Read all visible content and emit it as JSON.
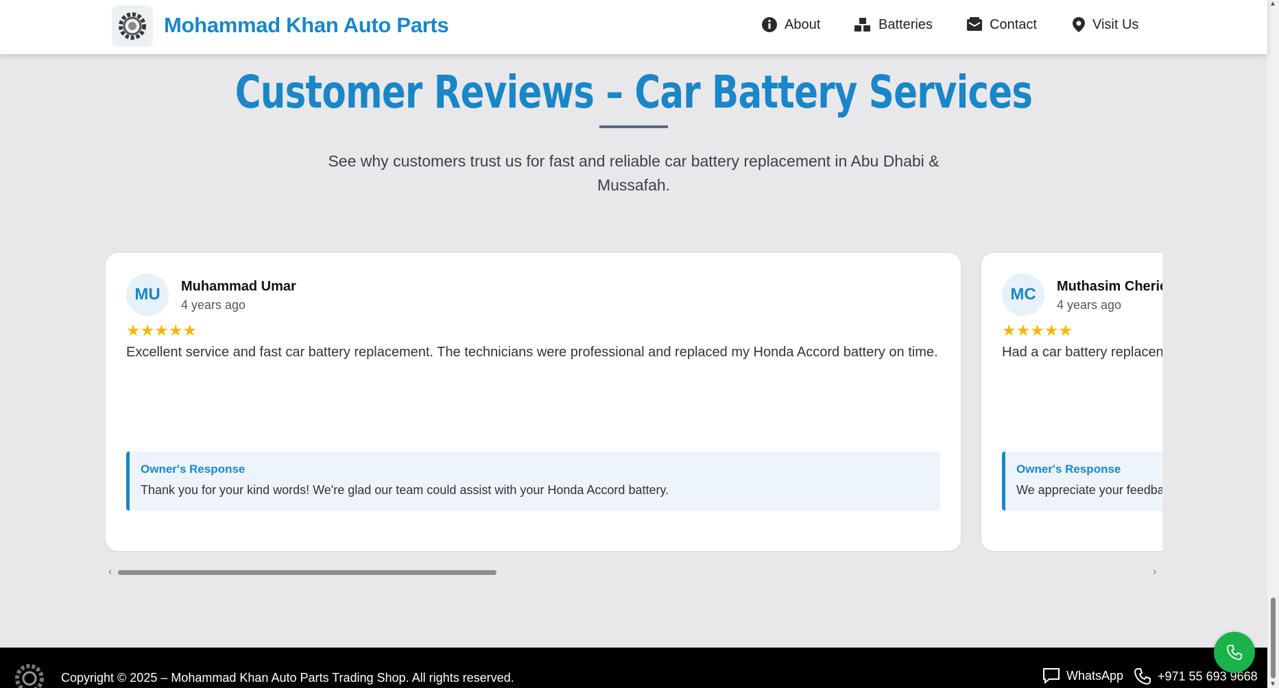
{
  "header": {
    "brand": "Mohammad Khan Auto Parts",
    "logo_icon": "gear-logo-icon",
    "nav": [
      {
        "label": "About",
        "icon": "info-icon"
      },
      {
        "label": "Batteries",
        "icon": "boxes-icon"
      },
      {
        "label": "Contact",
        "icon": "envelope-icon"
      },
      {
        "label": "Visit Us",
        "icon": "map-pin-icon"
      }
    ]
  },
  "section": {
    "title": "Customer Reviews – Car Battery Services",
    "subtitle": "See why customers trust us for fast and reliable car battery replacement in Abu Dhabi & Mussafah."
  },
  "reviews": [
    {
      "initials": "MU",
      "name": "Muhammad Umar",
      "time": "4 years ago",
      "stars": "★★★★★",
      "rating": 5,
      "text": "Excellent service and fast car battery replacement. The technicians were professional and replaced my Honda Accord battery on time.",
      "response_title": "Owner's Response",
      "response_text": "Thank you for your kind words! We're glad our team could assist with your Honda Accord battery."
    },
    {
      "initials": "MC",
      "name": "Muthasim Cheric",
      "time": "4 years ago",
      "stars": "★★★★★",
      "rating": 5,
      "text": "Had a car battery replacen",
      "response_title": "Owner's Response",
      "response_text": "We appreciate your feedbac"
    }
  ],
  "carousel": {
    "prev_glyph": "‹",
    "next_glyph": "›"
  },
  "footer": {
    "copyright": "Copyright © 2025 – Mohammad Khan Auto Parts Trading Shop. All rights reserved.",
    "whatsapp": "WhatsApp",
    "phone": "+971 55 693 9668"
  },
  "colors": {
    "brand": "#1a86c7",
    "star": "#f5b800",
    "fab": "#19b34a"
  }
}
